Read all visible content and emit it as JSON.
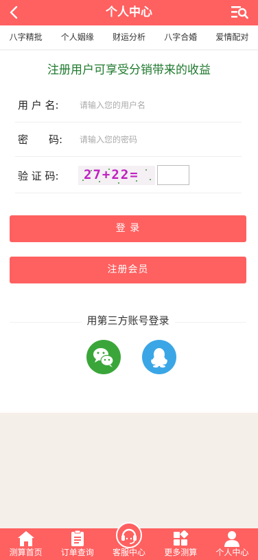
{
  "header": {
    "title": "个人中心",
    "back_icon": "chevron-left-icon",
    "menu_icon": "list-search-icon"
  },
  "categories": [
    "八字精批",
    "个人姻缘",
    "财运分析",
    "八字合婚",
    "爱情配对"
  ],
  "promo": "注册用户可享受分销带来的收益",
  "form": {
    "username_label": "用 户 名:",
    "username_placeholder": "请输入您的用户名",
    "password_label": "密　　码:",
    "password_placeholder": "请输入您的密码",
    "captcha_label": "验 证 码:",
    "captcha_text": "27+22="
  },
  "buttons": {
    "login": "登 录",
    "register": "注册会员"
  },
  "third_party": {
    "title": "用第三方账号登录",
    "providers": [
      "wechat",
      "qq"
    ]
  },
  "tabbar": [
    {
      "label": "测算首页",
      "icon": "home-icon"
    },
    {
      "label": "订单查询",
      "icon": "order-list-icon"
    },
    {
      "label": "客服中心",
      "icon": "headset-icon"
    },
    {
      "label": "更多测算",
      "icon": "grid-icon"
    },
    {
      "label": "个人中心",
      "icon": "user-icon"
    }
  ],
  "colors": {
    "brand": "#ff6060",
    "promo": "#1f7a2e",
    "wechat": "#3aa63a",
    "qq": "#3ba6e6",
    "page_bg": "#f5efea"
  }
}
